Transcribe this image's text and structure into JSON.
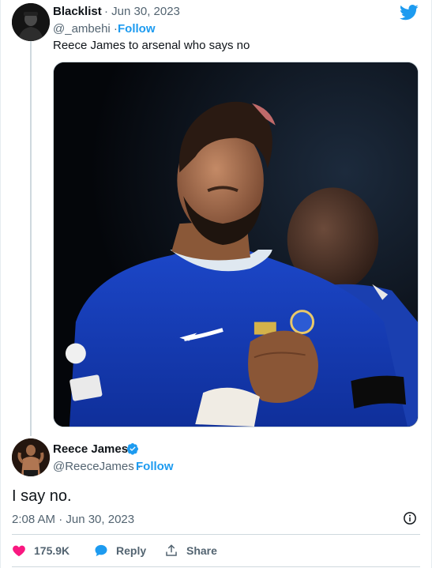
{
  "original_tweet": {
    "author_name": "Blacklist",
    "date": "· Jun 30, 2023",
    "handle": "@_ambehi ·",
    "follow_label": "Follow",
    "text": "Reece James to arsenal who says no"
  },
  "reply_tweet": {
    "author_name": "Reece James",
    "handle": "@ReeceJames ·",
    "follow_label": "Follow",
    "text": "I say no.",
    "timestamp": "2:08 AM · Jun 30, 2023"
  },
  "actions": {
    "like_count": "175.9K",
    "reply_label": "Reply",
    "share_label": "Share"
  },
  "icons": {
    "brand": "twitter-bird-icon",
    "verified": "verified-badge-icon",
    "info": "info-icon",
    "like": "heart-icon",
    "reply": "chat-bubble-icon",
    "share": "share-upload-icon"
  },
  "colors": {
    "accent": "#1d9bf0",
    "like": "#f91880",
    "text": "#0f1419",
    "muted": "#536471"
  }
}
